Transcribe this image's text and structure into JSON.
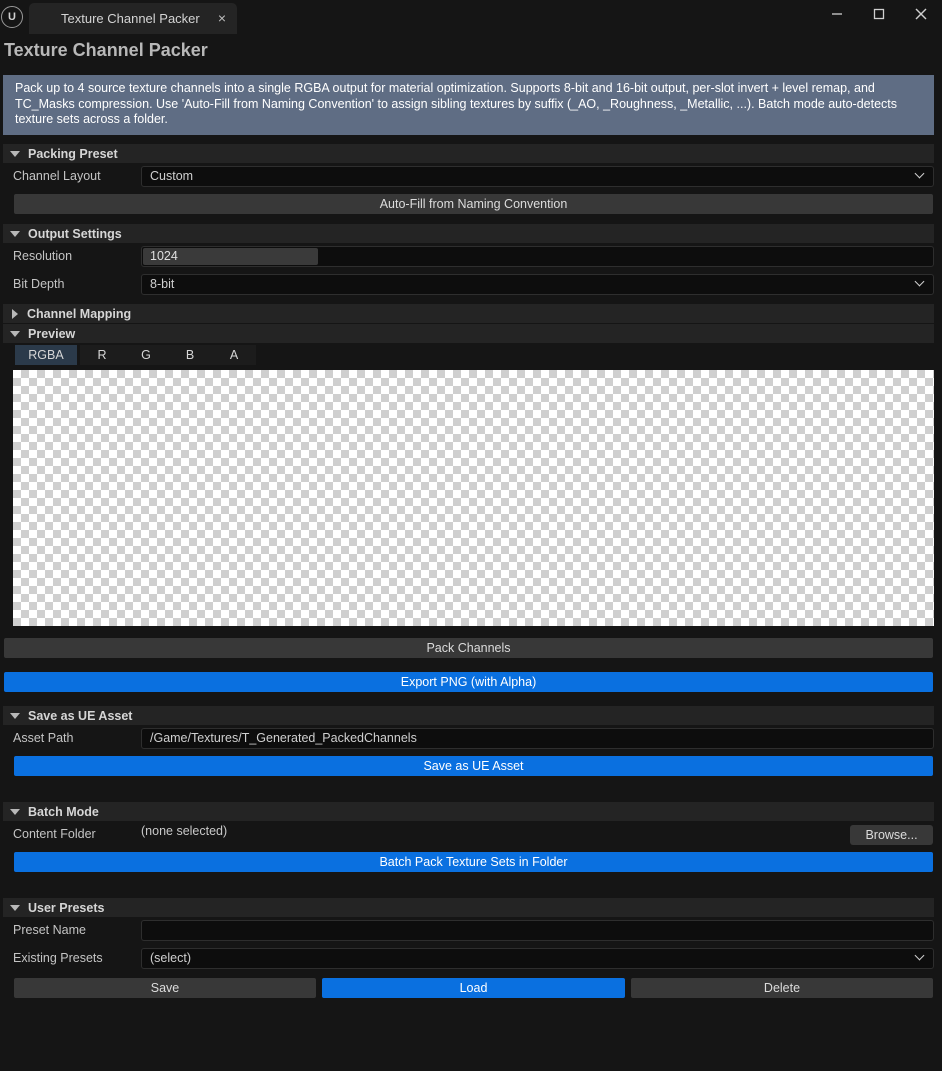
{
  "window": {
    "tab_title": "Texture Channel Packer",
    "tab_close": "×",
    "logo_text": "U",
    "minimize": "—",
    "maximize": "☐",
    "close": "✕"
  },
  "panel_title": "Texture Channel Packer",
  "info": "Pack up to 4 source texture channels into a single RGBA output for material optimization. Supports 8-bit and 16-bit output, per-slot invert + level remap, and TC_Masks compression. Use 'Auto-Fill from Naming Convention' to assign sibling textures by suffix (_AO, _Roughness, _Metallic, ...). Batch mode auto-detects texture sets across a folder.",
  "packing_preset": {
    "header": "Packing Preset",
    "channel_layout_label": "Channel Layout",
    "channel_layout_value": "Custom",
    "autofill_button": "Auto-Fill from Naming Convention"
  },
  "output_settings": {
    "header": "Output Settings",
    "resolution_label": "Resolution",
    "resolution_value": "1024",
    "bit_depth_label": "Bit Depth",
    "bit_depth_value": "8-bit"
  },
  "channel_mapping": {
    "header": "Channel Mapping"
  },
  "preview": {
    "header": "Preview",
    "tabs": [
      "RGBA",
      "R",
      "G",
      "B",
      "A"
    ],
    "selected_tab": "RGBA"
  },
  "actions": {
    "pack_button": "Pack Channels",
    "export_button": "Export PNG (with Alpha)"
  },
  "save_asset": {
    "header": "Save as UE Asset",
    "asset_path_label": "Asset Path",
    "asset_path_value": "/Game/Textures/T_Generated_PackedChannels",
    "save_button": "Save as UE Asset"
  },
  "batch_mode": {
    "header": "Batch Mode",
    "content_folder_label": "Content Folder",
    "content_folder_value": "(none selected)",
    "browse_button": "Browse...",
    "batch_button": "Batch Pack Texture Sets in Folder"
  },
  "user_presets": {
    "header": "User Presets",
    "preset_name_label": "Preset Name",
    "preset_name_value": "",
    "existing_presets_label": "Existing Presets",
    "existing_presets_value": "(select)",
    "save_button": "Save",
    "load_button": "Load",
    "delete_button": "Delete"
  },
  "colors": {
    "background": "#151515",
    "accent_blue": "#0a70e0",
    "info_box": "#5f6d84",
    "section_header": "#242424"
  }
}
